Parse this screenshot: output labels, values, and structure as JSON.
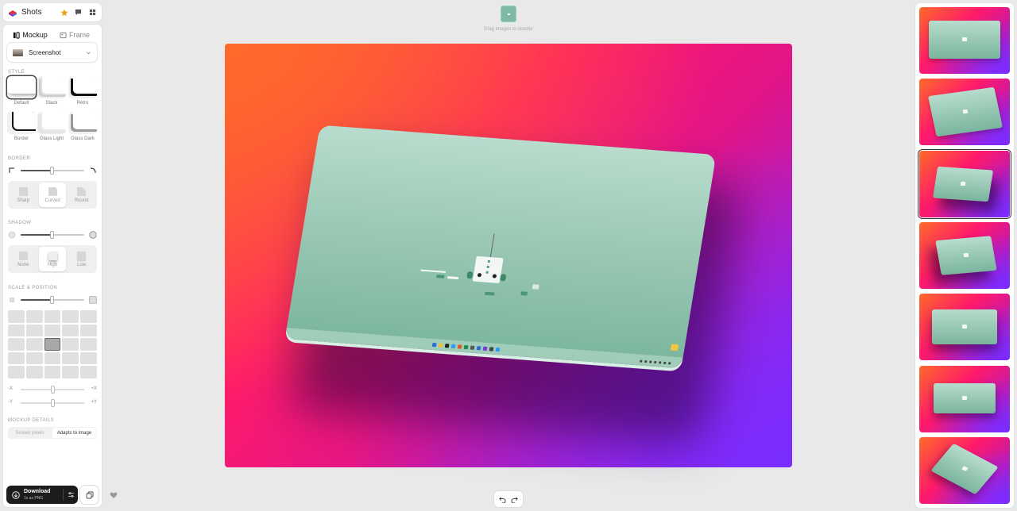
{
  "app": {
    "title": "Shots"
  },
  "mode_tabs": [
    {
      "label": "Mockup",
      "active": true
    },
    {
      "label": "Frame",
      "active": false
    }
  ],
  "device_select": {
    "value": "Screenshot"
  },
  "sections": {
    "style": "STYLE",
    "border": "BORDER",
    "shadow": "SHADOW",
    "scale_position": "SCALE & POSITION",
    "mockup_details": "MOCKUP DETAILS"
  },
  "styles": [
    {
      "label": "Default",
      "selected": true
    },
    {
      "label": "Stack",
      "selected": false
    },
    {
      "label": "Retro",
      "selected": false
    },
    {
      "label": "Border",
      "selected": false
    },
    {
      "label": "Glass Light",
      "selected": false
    },
    {
      "label": "Glass Dark",
      "selected": false
    }
  ],
  "border_options": [
    {
      "label": "Sharp",
      "active": false
    },
    {
      "label": "Curved",
      "active": true
    },
    {
      "label": "Round",
      "active": false
    }
  ],
  "shadow_options": [
    {
      "label": "None",
      "active": false
    },
    {
      "label": "High",
      "active": true
    },
    {
      "label": "Low",
      "active": false
    }
  ],
  "position_axes": {
    "x_min": "-X",
    "x_max": "+X",
    "y_min": "-Y",
    "y_max": "+Y"
  },
  "details_options": [
    {
      "label": "Screen pixels",
      "active": false
    },
    {
      "label": "Adapts to image",
      "active": true
    }
  ],
  "download": {
    "label": "Download",
    "sublabel": "1x as PNG"
  },
  "drag_hint": "Drag images to reorder",
  "colors": {
    "accent_dark": "#1c1c1c",
    "bg_orange": "#ff6a2a",
    "bg_pink": "#ff1a6a",
    "bg_purple": "#7a2cff",
    "device_green": "#9cc9b6",
    "star": "#e8a317"
  },
  "icons": {
    "app_logo": "shots-logo-icon",
    "favorite": "star-icon",
    "feedback": "chat-icon",
    "apps": "grid-icon",
    "download": "download-icon",
    "settings": "sliders-icon",
    "copy": "copy-icon",
    "like": "heart-icon",
    "undo": "undo-icon",
    "redo": "redo-icon"
  }
}
